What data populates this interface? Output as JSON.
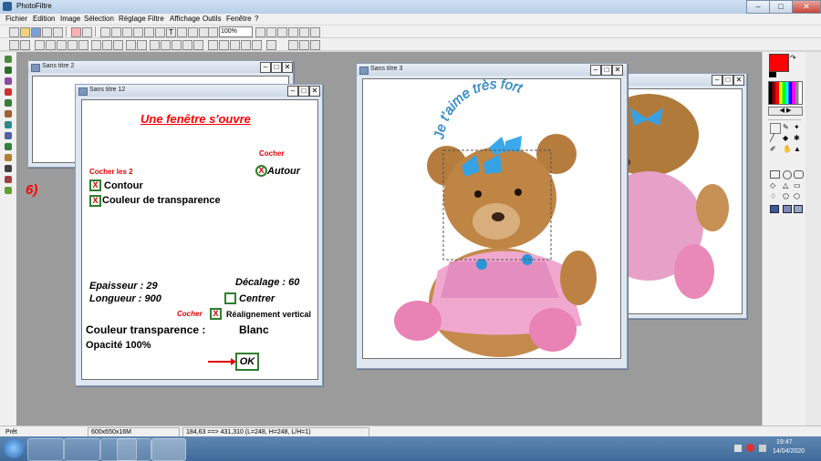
{
  "app": {
    "title": "PhotoFiltre"
  },
  "window_controls": {
    "minimize": "–",
    "maximize": "□",
    "close": "✕"
  },
  "menu": [
    "Fichier",
    "Edition",
    "Image",
    "Sélection",
    "Réglage",
    "Filtre",
    "Affichage",
    "Outils",
    "Fenêtre",
    "?"
  ],
  "toolbar": {
    "zoom_value": "100%"
  },
  "documents": {
    "doc2": {
      "title": "Sans titre 2"
    },
    "doc12": {
      "title": "Sans titre 12"
    },
    "doc3": {
      "title": "Sans titre 3"
    }
  },
  "step_label": "6)",
  "tutorial": {
    "heading": "Une fenêtre s'ouvre",
    "cocher_top": "Cocher",
    "autour": "Autour",
    "cocher_les_2": "Cocher les 2",
    "contour": "Contour",
    "couleur_transparence_opt": "Couleur de transparence",
    "epaisseur": "Epaisseur : 29",
    "decalage": "Décalage : 60",
    "longueur": "Longueur : 900",
    "centrer": "Centrer",
    "cocher_bottom": "Cocher",
    "realignement": "Réalignement vertical",
    "couleur_transparence": "Couleur transparence :",
    "blanc": "Blanc",
    "opacite": "Opacité 100%",
    "ok": "OK",
    "check_mark": "X"
  },
  "curved_text": "Je t'aime très fort",
  "status": {
    "ready": "Prêt",
    "size": "600x650x16M",
    "coords": "184,63 ==> 431,310 (L=248, H=248, L/H=1)"
  },
  "clock": {
    "time": "19:47",
    "date": "14/04/2020"
  },
  "colors": {
    "foreground": "#ff0000",
    "background": "#ffffff",
    "accent_red": "#ff0000",
    "check_green": "#2f7f2f",
    "teddy_ribbon": "#3aa0e0"
  }
}
